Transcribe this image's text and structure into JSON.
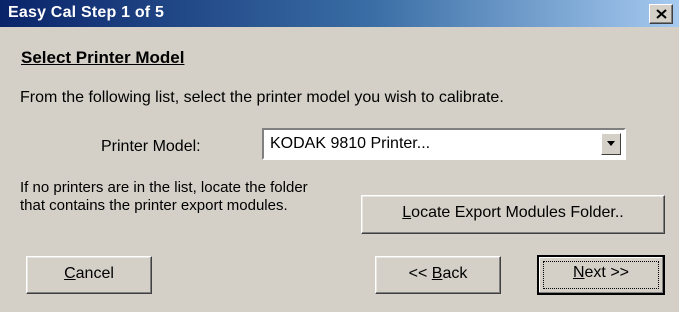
{
  "window": {
    "title": "Easy Cal Step 1 of 5",
    "close_icon": "close-x-icon"
  },
  "page": {
    "heading": "Select Printer Model",
    "instruction": "From the following list, select the printer model you wish to calibrate.",
    "printer_model_label": "Printer Model:",
    "printer_model_value": "KODAK 9810 Printer...",
    "dropdown_icon": "chevron-down-icon",
    "hint": "If no printers are in the list, locate the folder that contains the printer export modules."
  },
  "buttons": {
    "locate": {
      "mnemonic": "L",
      "rest": "ocate Export Modules Folder.."
    },
    "cancel": {
      "mnemonic": "C",
      "rest": "ancel"
    },
    "back": {
      "prefix": "<< ",
      "mnemonic": "B",
      "rest": "ack"
    },
    "next": {
      "mnemonic": "N",
      "rest": "ext >>"
    }
  },
  "colors": {
    "titlebar_start": "#0a246a",
    "titlebar_end": "#a6caf0",
    "face": "#d4d0c8"
  }
}
